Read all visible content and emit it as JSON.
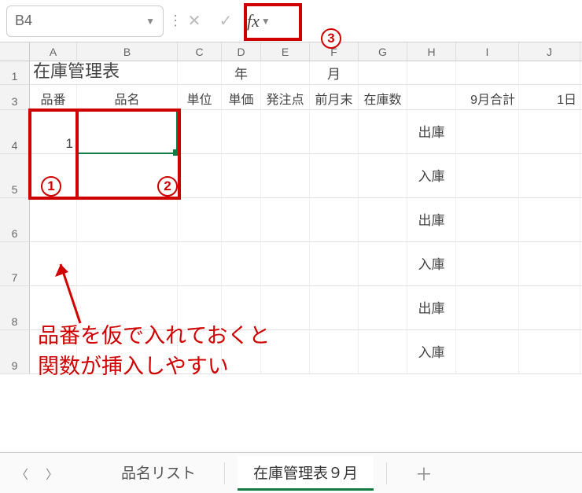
{
  "formula_bar": {
    "cell_reference": "B4",
    "fx_label": "fx"
  },
  "columns": [
    "A",
    "B",
    "C",
    "D",
    "E",
    "F",
    "G",
    "H",
    "I",
    "J"
  ],
  "rows_shown": [
    1,
    3,
    4,
    5,
    6,
    7,
    8,
    9
  ],
  "title": "在庫管理表",
  "period": {
    "year_label": "年",
    "month_label": "月"
  },
  "headers": {
    "A": "品番",
    "B": "品名",
    "C": "単位",
    "D": "単価",
    "E": "発注点",
    "F": "前月末",
    "G": "在庫数",
    "I": "9月合計",
    "J": "1日"
  },
  "cells": {
    "A4": "1"
  },
  "stock_rows": [
    "出庫",
    "入庫",
    "出庫",
    "入庫",
    "出庫",
    "入庫"
  ],
  "annotation": {
    "line1": "品番を仮で入れておくと",
    "line2": "関数が挿入しやすい",
    "n1": "1",
    "n2": "2",
    "n3": "3"
  },
  "tabs": {
    "list": "品名リスト",
    "active": "在庫管理表９月"
  }
}
